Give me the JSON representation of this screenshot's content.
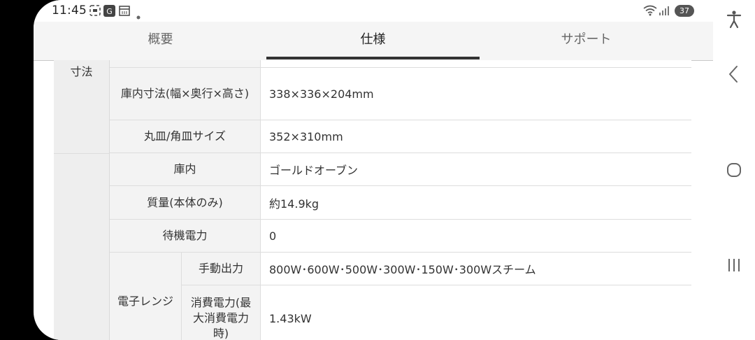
{
  "status_bar": {
    "time": "11:45",
    "notification_icons": [
      "screenshot-icon",
      "g-app-icon",
      "calendar-icon",
      "more-dot-icon"
    ],
    "system_icons": [
      "wifi-icon",
      "signal-icon"
    ],
    "battery": "37"
  },
  "tabs": [
    {
      "label": "概要",
      "active": false
    },
    {
      "label": "仕様",
      "active": true
    },
    {
      "label": "サポート",
      "active": false
    }
  ],
  "spec_table": {
    "group_dimensions": "寸法",
    "row_inner_size": {
      "label": "庫内寸法(幅×奥行×高さ)",
      "value": "338×336×204mm"
    },
    "row_plate_size": {
      "label": "丸皿/角皿サイズ",
      "value": "352×310mm"
    },
    "row_interior": {
      "label": "庫内",
      "value": "ゴールドオーブン"
    },
    "row_weight": {
      "label": "質量(本体のみ)",
      "value": "約14.9kg"
    },
    "row_standby": {
      "label": "待機電力",
      "value": "0"
    },
    "group_microwave": "電子レンジ",
    "row_manual_output": {
      "label": "手動出力",
      "value": "800W･600W･500W･300W･150W･300Wスチーム"
    },
    "row_power_consumption": {
      "label": "消費電力(最大消費電力時)",
      "value": "1.43kW"
    }
  },
  "colors": {
    "active_tab_indicator": "#333333",
    "label_background": "#f3f3f3",
    "group_background": "#eeeeee"
  }
}
